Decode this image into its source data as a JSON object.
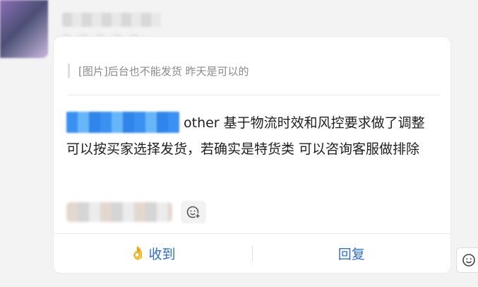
{
  "quote": {
    "text": "[图片]后台也不能发货 昨天是可以的"
  },
  "message": {
    "text_line": "other 基于物流时效和风控要求做了调整 可以按买家选择发货，若确实是特货类 可以咨询客服做排除"
  },
  "actions": {
    "received_label": "收到",
    "reply_label": "回复"
  },
  "icons": {
    "received_hand": "ok-hand-icon",
    "reaction": "smiley-add-icon",
    "side_emoji": "smiley-icon"
  },
  "colors": {
    "accent": "#2f6fd3",
    "background": "#f3f3f4",
    "card": "#ffffff"
  }
}
